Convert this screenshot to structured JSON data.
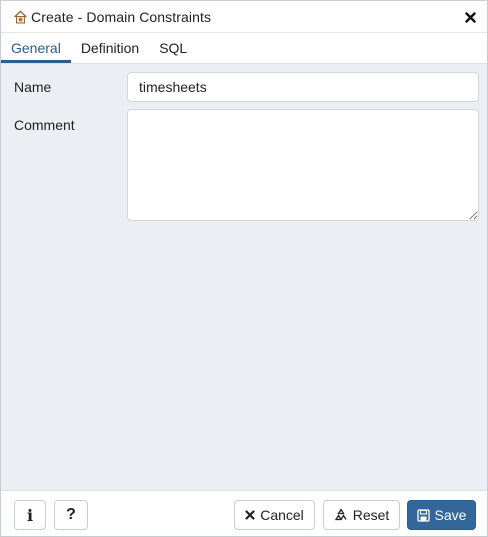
{
  "dialog": {
    "title": "Create - Domain Constraints",
    "title_icon": "domain-constraint-icon",
    "close_icon": "close-icon"
  },
  "tabs": [
    {
      "label": "General",
      "active": true
    },
    {
      "label": "Definition",
      "active": false
    },
    {
      "label": "SQL",
      "active": false
    }
  ],
  "form": {
    "name_label": "Name",
    "name_value": "timesheets",
    "comment_label": "Comment",
    "comment_value": ""
  },
  "footer": {
    "info_label": "i",
    "help_label": "?",
    "cancel_label": "Cancel",
    "reset_label": "Reset",
    "save_label": "Save",
    "save_color": "#336699"
  }
}
